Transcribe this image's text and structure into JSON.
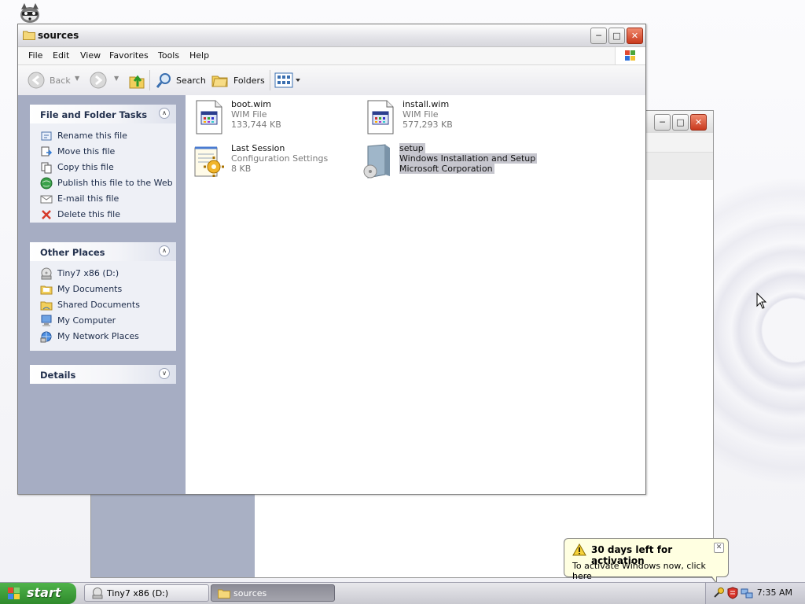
{
  "window": {
    "title": "sources",
    "menu": [
      "File",
      "Edit",
      "View",
      "Favorites",
      "Tools",
      "Help"
    ],
    "toolbar": {
      "back": "Back",
      "search": "Search",
      "folders": "Folders"
    }
  },
  "panels": {
    "file_tasks": {
      "title": "File and Folder Tasks",
      "items": [
        {
          "label": "Rename this file",
          "icon": "rename-icon"
        },
        {
          "label": "Move this file",
          "icon": "move-icon"
        },
        {
          "label": "Copy this file",
          "icon": "copy-icon"
        },
        {
          "label": "Publish this file to the Web",
          "icon": "publish-web-icon"
        },
        {
          "label": "E-mail this file",
          "icon": "email-icon"
        },
        {
          "label": "Delete this file",
          "icon": "delete-icon"
        }
      ]
    },
    "other_places": {
      "title": "Other Places",
      "items": [
        {
          "label": "Tiny7 x86 (D:)",
          "icon": "drive-icon"
        },
        {
          "label": "My Documents",
          "icon": "my-documents-icon"
        },
        {
          "label": "Shared Documents",
          "icon": "shared-documents-icon"
        },
        {
          "label": "My Computer",
          "icon": "my-computer-icon"
        },
        {
          "label": "My Network Places",
          "icon": "network-places-icon"
        }
      ]
    },
    "details": {
      "title": "Details"
    }
  },
  "files": [
    {
      "name": "boot.wim",
      "line2": "WIM File",
      "line3": "133,744 KB",
      "icon": "wim-file-icon",
      "selected": false
    },
    {
      "name": "install.wim",
      "line2": "WIM File",
      "line3": "577,293 KB",
      "icon": "wim-file-icon",
      "selected": false
    },
    {
      "name": "Last Session",
      "line2": "Configuration Settings",
      "line3": "8 KB",
      "icon": "config-file-icon",
      "selected": false
    },
    {
      "name": "setup",
      "line2": "Windows Installation and Setup",
      "line3": "Microsoft Corporation",
      "icon": "setup-exe-icon",
      "selected": true
    }
  ],
  "balloon": {
    "title": "30 days left for activation",
    "body": "To activate Windows now, click here"
  },
  "taskbar": {
    "start": "start",
    "tasks": [
      {
        "label": "Tiny7 x86 (D:)",
        "icon": "drive-icon",
        "active": false
      },
      {
        "label": "sources",
        "icon": "folder-icon",
        "active": true
      }
    ],
    "clock": "7:35 AM"
  },
  "colors": {
    "left_pane": "#a6adc3",
    "selection": "#c6c6ce",
    "start_button": "#3a9b35",
    "balloon_bg": "#ffffe1"
  }
}
